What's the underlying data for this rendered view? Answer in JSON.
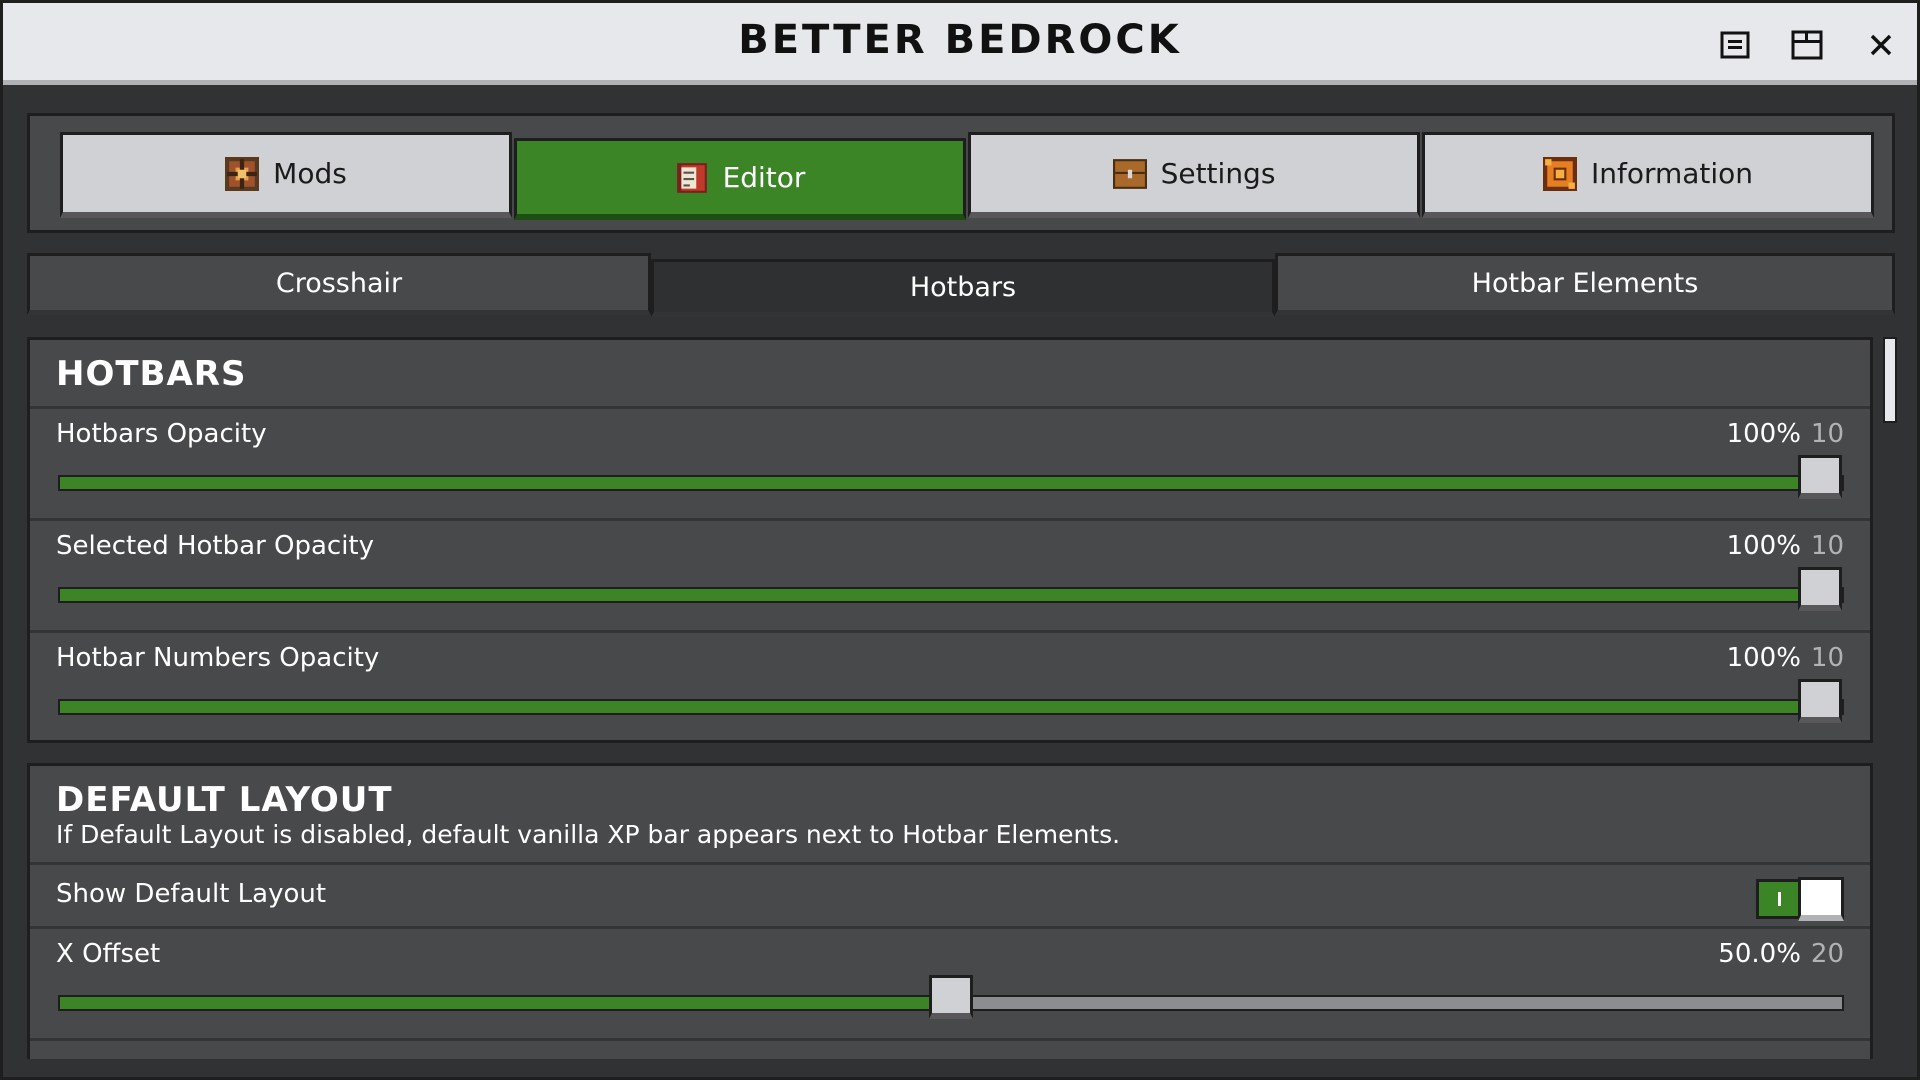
{
  "window": {
    "title": "BETTER BEDROCK"
  },
  "main_tabs": [
    {
      "label": "Mods",
      "icon": "mods-icon",
      "active": false
    },
    {
      "label": "Editor",
      "icon": "editor-book-icon",
      "active": true
    },
    {
      "label": "Settings",
      "icon": "settings-chest-icon",
      "active": false
    },
    {
      "label": "Information",
      "icon": "information-icon",
      "active": false
    }
  ],
  "sub_tabs": [
    {
      "label": "Crosshair",
      "active": false
    },
    {
      "label": "Hotbars",
      "active": true
    },
    {
      "label": "Hotbar Elements",
      "active": false
    }
  ],
  "hotbars_section": {
    "title": "HOTBARS",
    "rows": [
      {
        "label": "Hotbars Opacity",
        "percent": "100%",
        "value": "10",
        "fraction": 1.0
      },
      {
        "label": "Selected Hotbar Opacity",
        "percent": "100%",
        "value": "10",
        "fraction": 1.0
      },
      {
        "label": "Hotbar Numbers Opacity",
        "percent": "100%",
        "value": "10",
        "fraction": 1.0
      }
    ]
  },
  "layout_section": {
    "title": "DEFAULT LAYOUT",
    "description": "If Default Layout is disabled, default vanilla XP bar appears next to Hotbar Elements.",
    "toggle_label": "Show Default Layout",
    "toggle_on": true,
    "x_offset": {
      "label": "X Offset",
      "percent": "50.0%",
      "value": "20",
      "fraction": 0.5
    }
  },
  "colors": {
    "accent_green": "#3c8527",
    "panel": "#48494a",
    "titlebar": "#e6e8eb"
  }
}
